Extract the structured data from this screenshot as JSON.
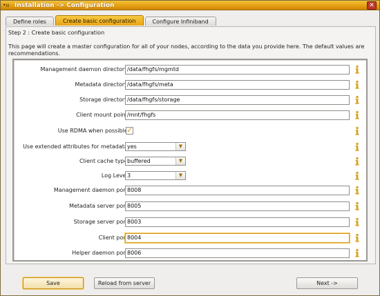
{
  "window": {
    "title": "Installation -> Configuration",
    "system_menu": "•ıı",
    "close_glyph": "✕"
  },
  "tabs": [
    {
      "label": "Define roles"
    },
    {
      "label": "Create basic configuration"
    },
    {
      "label": "Configure Infiniband"
    }
  ],
  "page": {
    "step": "Step 2 : Create basic configuration",
    "description": "This page will create a master configuration for all of your nodes, according to the data you provide here. The default values are recommendations."
  },
  "form": {
    "mgmtd_dir": {
      "label": "Management daemon directory :",
      "value": "/data/fhgfs/mgmtd"
    },
    "meta_dir": {
      "label": "Metadata directory :",
      "value": "/data/fhgfs/meta"
    },
    "storage_dir": {
      "label": "Storage directory :",
      "value": "/data/fhgfs/storage"
    },
    "client_mount": {
      "label": "Client mount point :",
      "value": "/mnt/fhgfs"
    },
    "use_rdma": {
      "label": "Use RDMA when possible :",
      "checked": true,
      "check_glyph": "✓"
    },
    "ext_attrs": {
      "label": "Use extended attributes for metadata :",
      "value": "yes"
    },
    "cache_type": {
      "label": "Client cache type :",
      "value": "buffered"
    },
    "log_level": {
      "label": "Log Level :",
      "value": "3"
    },
    "mgmtd_port": {
      "label": "Management daemon port :",
      "value": "8008"
    },
    "meta_port": {
      "label": "Metadata server port :",
      "value": "8005"
    },
    "storage_port": {
      "label": "Storage server port :",
      "value": "8003"
    },
    "client_port": {
      "label": "Client port :",
      "value": "8004"
    },
    "helper_port": {
      "label": "Helper daemon port :",
      "value": "8006"
    },
    "info_icon": "info-icon"
  },
  "buttons": {
    "save": "Save",
    "reload": "Reload from server",
    "next": "Next ->"
  },
  "colors": {
    "accent": "#e8a416",
    "info_icon": "#d6a21a"
  }
}
